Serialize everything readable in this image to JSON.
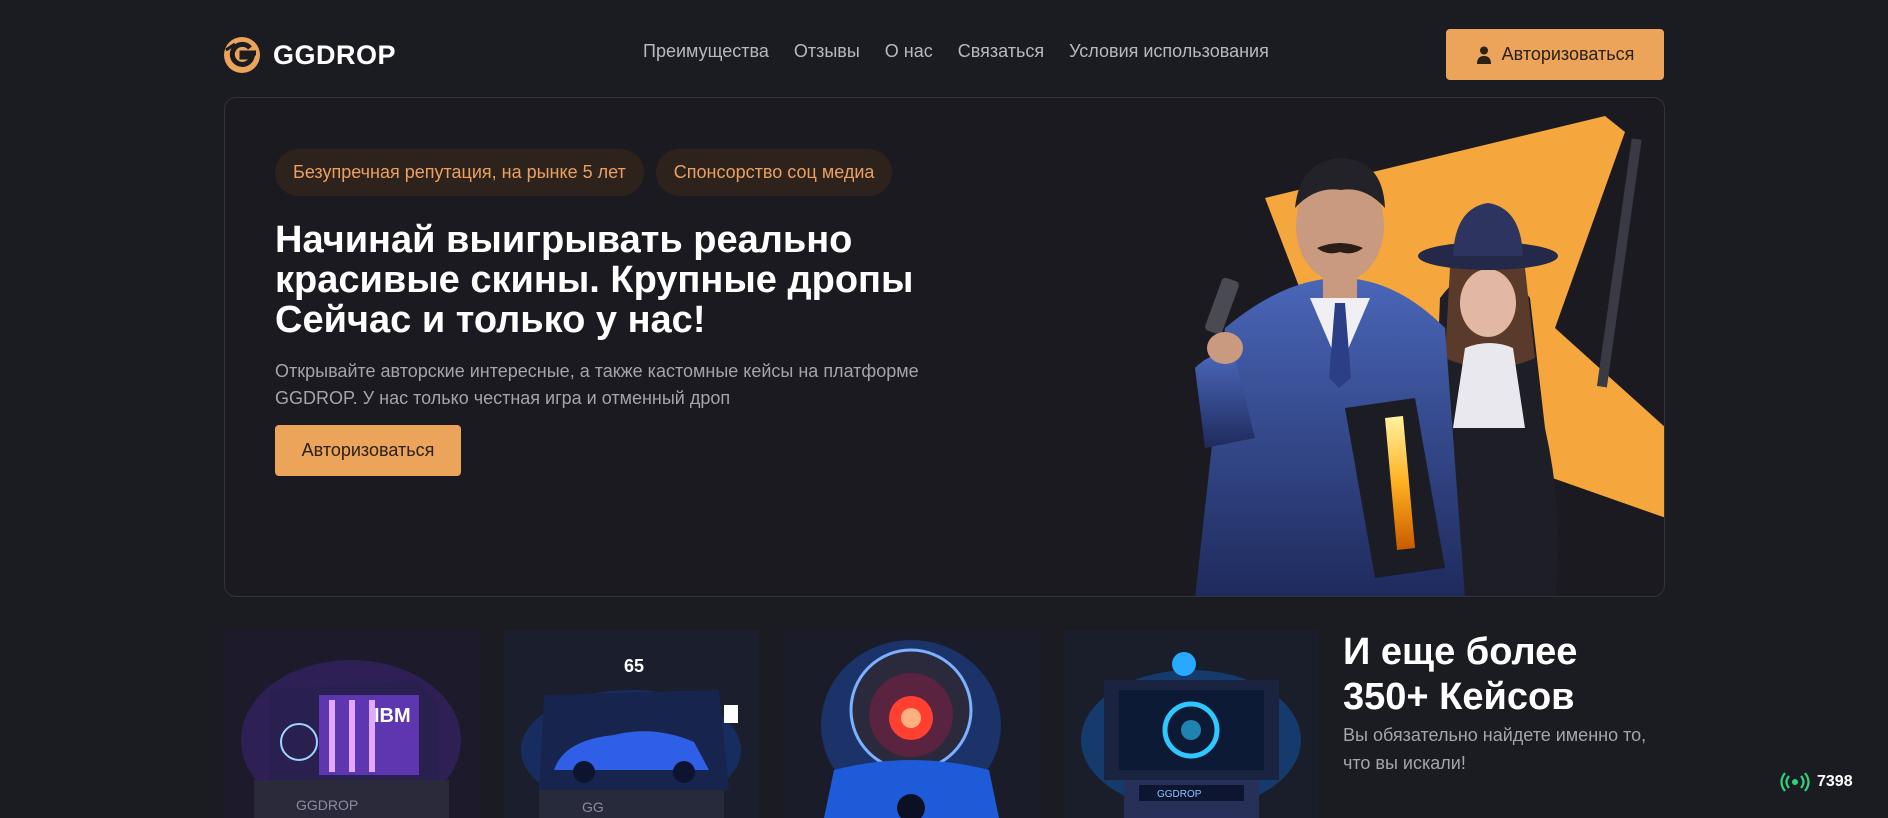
{
  "brand": {
    "name": "GGDROP",
    "accent": "#eba45a"
  },
  "nav": [
    "Преимущества",
    "Отзывы",
    "О нас",
    "Связаться",
    "Условия использования"
  ],
  "header": {
    "login_label": "Авторизоваться"
  },
  "hero": {
    "badges": [
      "Безупречная репутация, на рынке 5 лет",
      "Спонсорство соц медиа"
    ],
    "title": "Начинай выигрывать реально красивые скины. Крупные дропы Сейчас и только у нас!",
    "subtitle": "Открывайте авторские интересные, а также кастомные кейсы на платформе GGDROP. У нас только честная игра и отменный дроп",
    "cta_label": "Авторизоваться"
  },
  "cases": {
    "more_title": "И еще более 350+ Кейсов",
    "more_subtitle": "Вы обязательно найдете именно то, что вы искали!",
    "items": [
      {
        "icon": "ibm-case-icon",
        "label": "IBM",
        "plate": "GGDROP"
      },
      {
        "icon": "car-case-icon",
        "label": "65",
        "plate": "GG"
      },
      {
        "icon": "orb-case-icon"
      },
      {
        "icon": "ai-case-icon",
        "plate": "GGDROP"
      }
    ]
  },
  "online": {
    "count": "7398",
    "icon": "broadcast-icon"
  }
}
